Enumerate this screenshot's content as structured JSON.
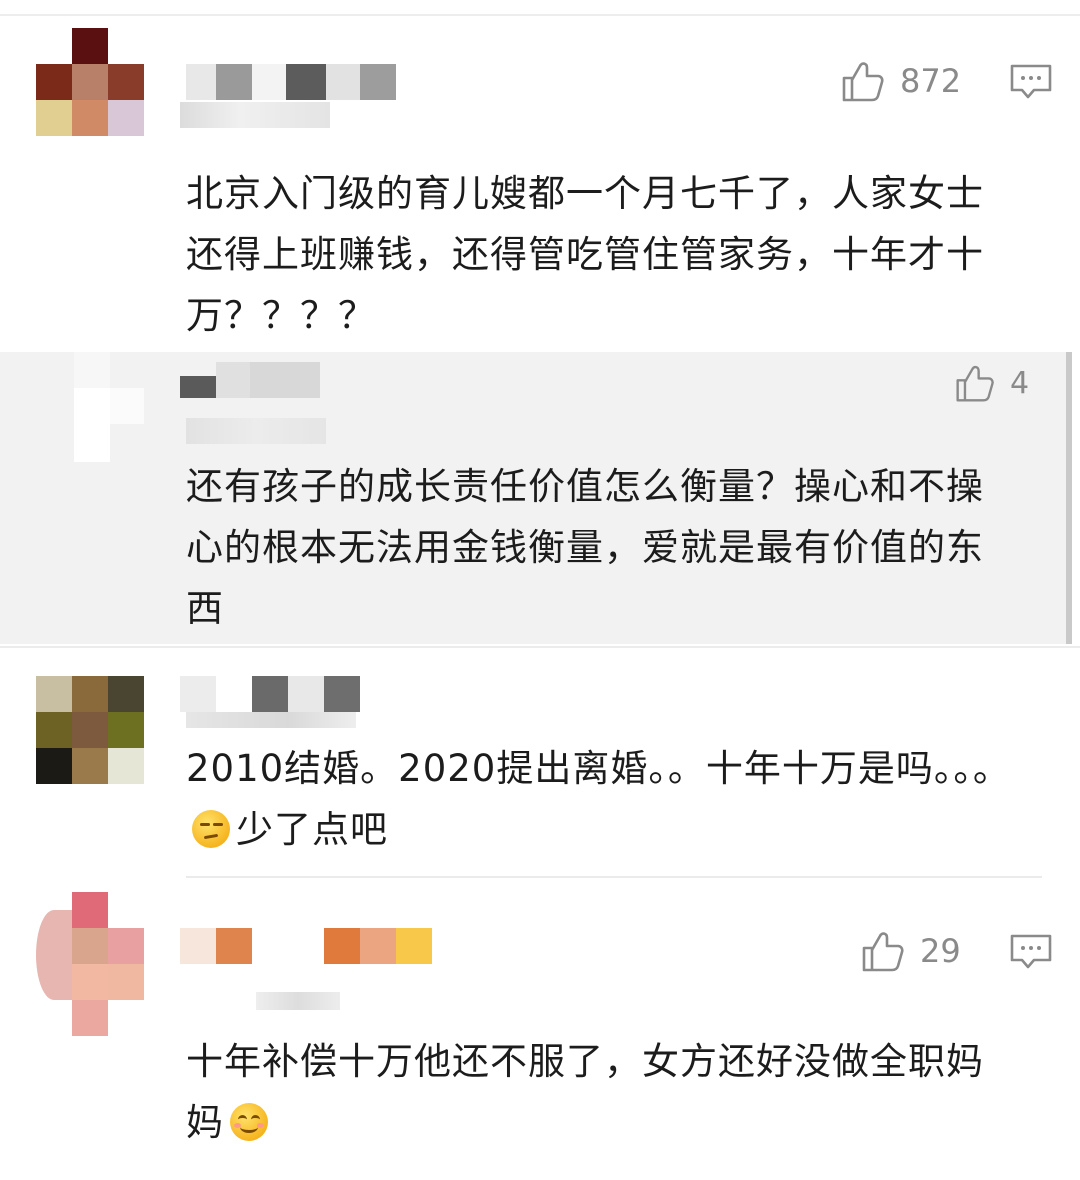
{
  "comments": [
    {
      "likes": "872",
      "text": "北京入门级的育儿嫂都一个月七千了，人家女士还得上班赚钱，还得管吃管住管家务，十年才十万？？？？"
    },
    {
      "likes": "4",
      "text": "还有孩子的成长责任价值怎么衡量？操心和不操心的根本无法用金钱衡量，爱就是最有价值的东西"
    },
    {
      "text_before_emoji": "2010结婚。2020提出离婚。。十年十万是吗。。。",
      "emoji": "smirk-emoji",
      "text_after_emoji": "少了点吧"
    },
    {
      "likes": "29",
      "text_before_emoji": "十年补偿十万他还不服了，女方还好没做全职妈妈",
      "emoji": "smile-emoji"
    }
  ],
  "icons": {
    "like": "thumbs-up-icon",
    "reply": "comment-icon"
  },
  "colors": {
    "text": "#1c1c1c",
    "meta": "#8a8a8a",
    "reply_bg": "#f2f2f2"
  }
}
